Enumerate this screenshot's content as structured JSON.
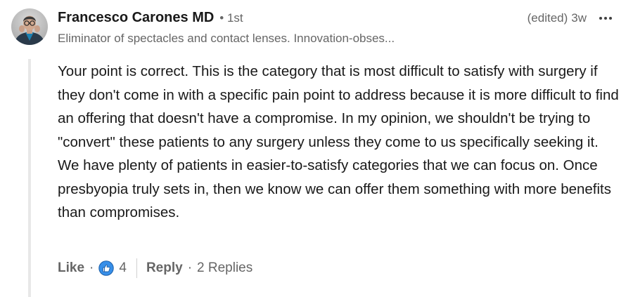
{
  "author": {
    "name": "Francesco Carones MD",
    "degree": "• 1st",
    "headline": "Eliminator of spectacles and contact lenses. Innovation-obses..."
  },
  "meta": {
    "edited": "(edited)",
    "time": "3w",
    "more_icon": "more-horizontal-icon"
  },
  "comment": {
    "text": "Your point is correct. This is the category that is most difficult to satisfy with surgery if they don't come in with a specific pain point to address because it is more difficult to find an offering that doesn't have a compromise. In my opinion, we shouldn't be trying to \"convert\" these patients to any surgery unless they come to us specifically seeking it. We have plenty of patients in easier-to-satisfy categories that we can focus on. Once presbyopia truly sets in, then we know we can offer them something with more benefits than compromises."
  },
  "actions": {
    "like_label": "Like",
    "dot1": "·",
    "reaction_icon": "thumbs-up-icon",
    "reaction_color": "#378fe9",
    "reaction_count": "4",
    "reply_label": "Reply",
    "dot2": "·",
    "replies_label": "2 Replies"
  }
}
